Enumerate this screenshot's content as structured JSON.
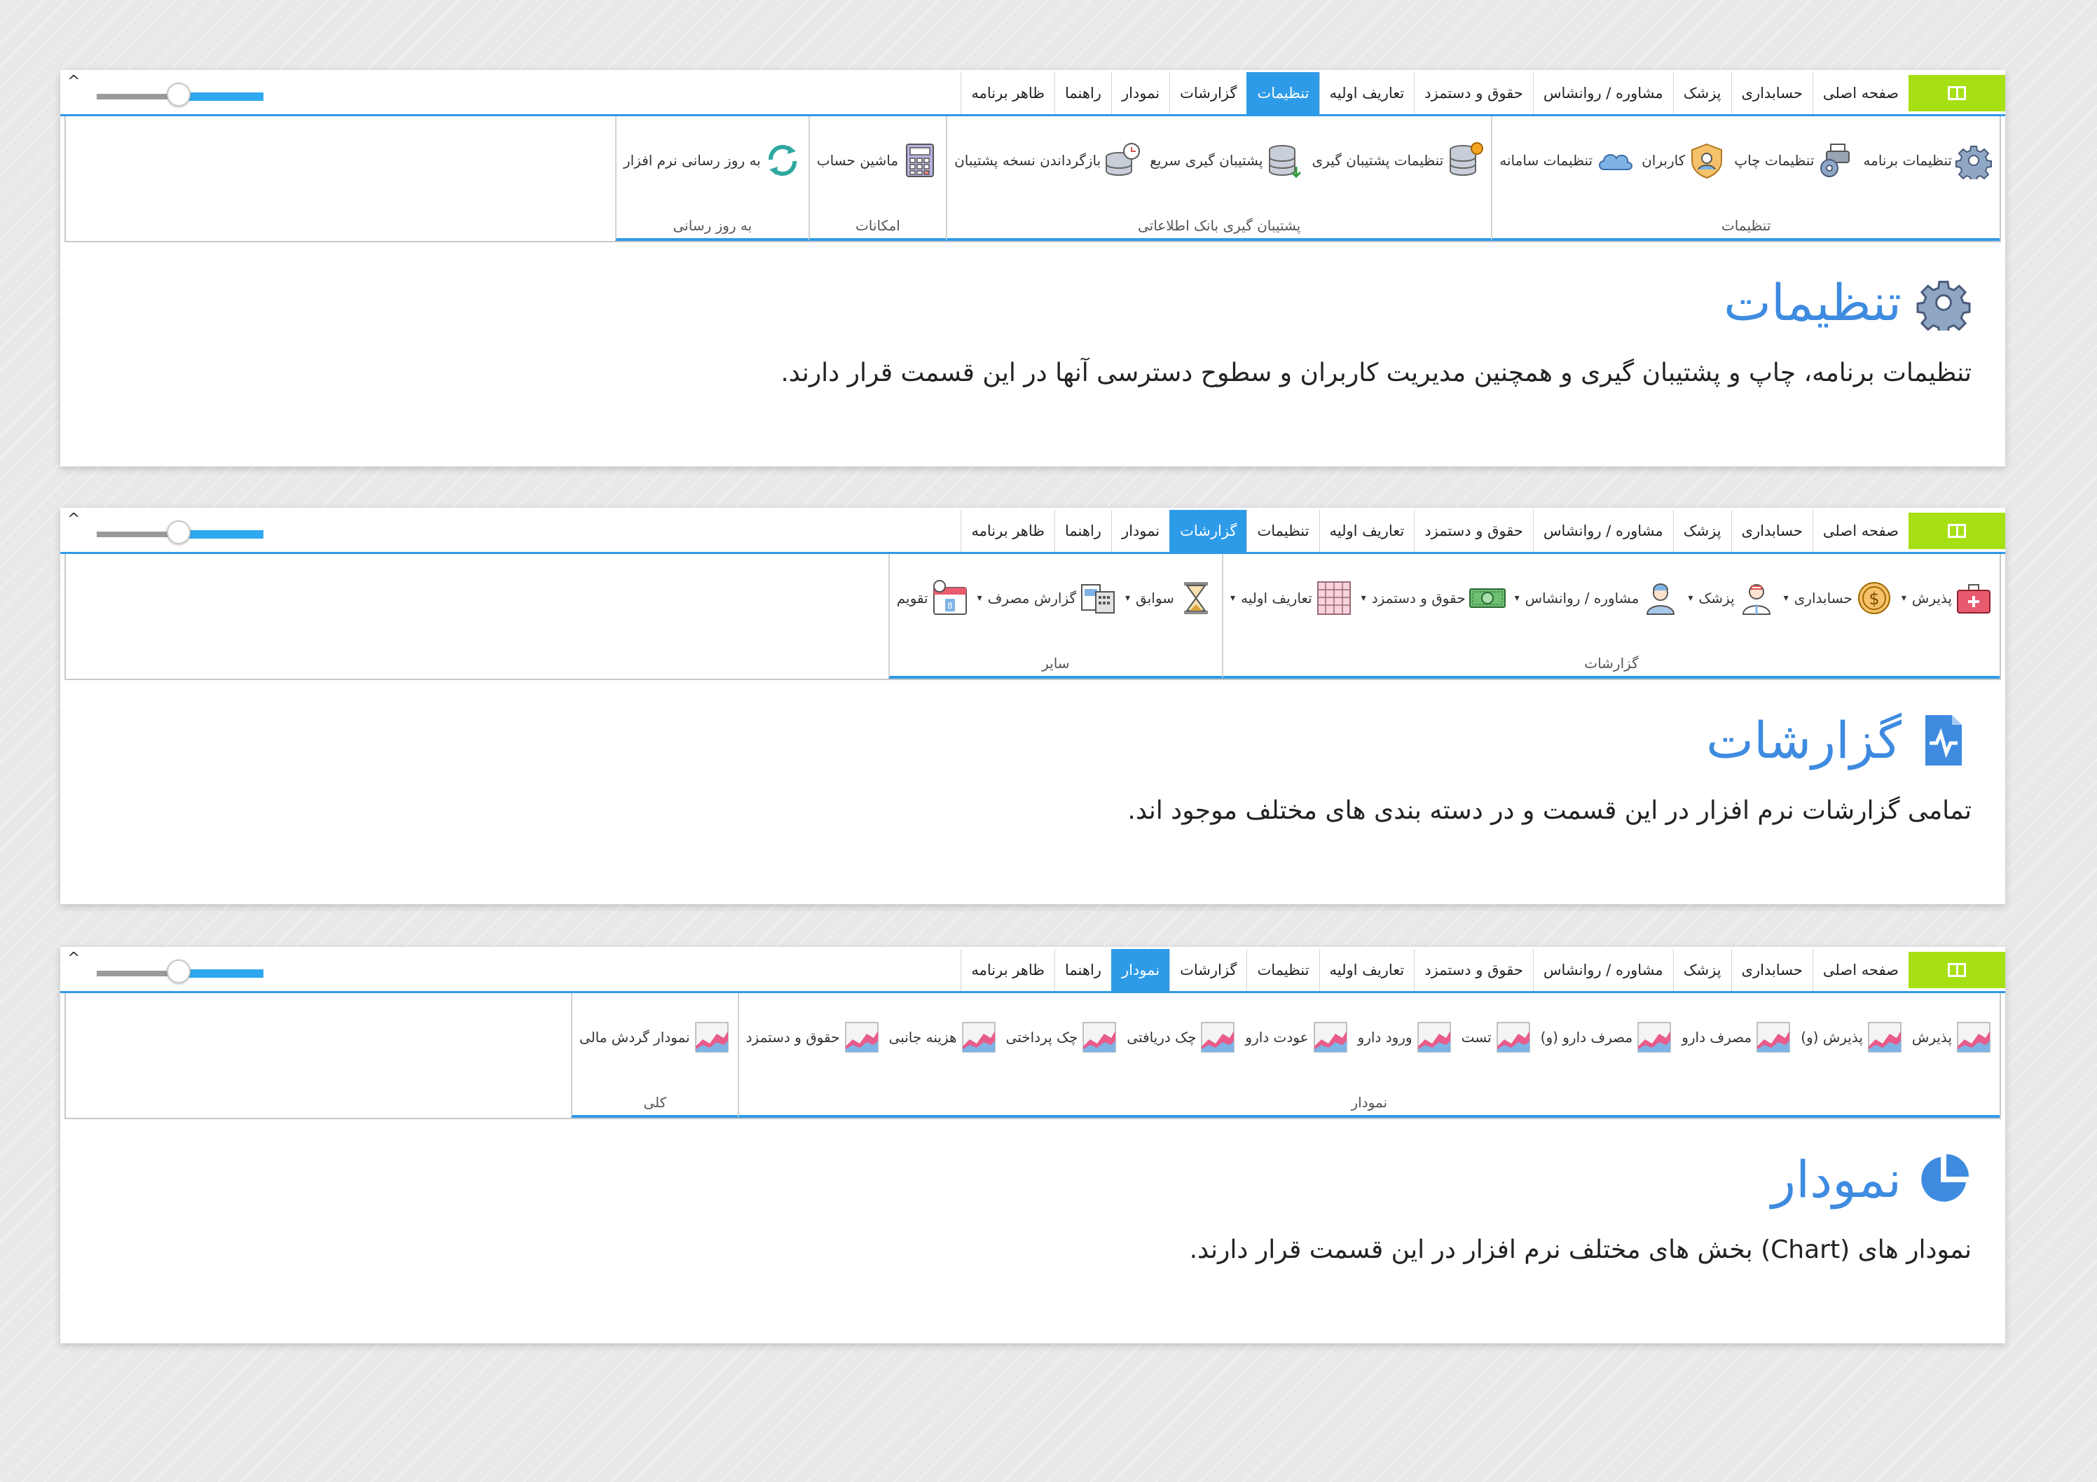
{
  "tabs": [
    "صفحه اصلی",
    "حسابداری",
    "پزشک",
    "مشاوره / روانشاس",
    "حقوق و دستمزد",
    "تعاریف اولیه",
    "تنظیمات",
    "گزارشات",
    "نمودار",
    "راهنما",
    "ظاهر برنامه"
  ],
  "collapse_glyph": "^",
  "colors": {
    "accent": "#2e9be8",
    "app_button": "#a6e012",
    "heading": "#3e8be0"
  },
  "panels": [
    {
      "active_tab": "تنظیمات",
      "groups": [
        {
          "label": "تنظیمات",
          "items": [
            {
              "label": "تنظیمات برنامه",
              "icon": "gear-icon",
              "dropdown": false
            },
            {
              "label": "تنظیمات چاپ",
              "icon": "print-settings-icon",
              "dropdown": false
            },
            {
              "label": "کاربران",
              "icon": "user-shield-icon",
              "dropdown": false
            },
            {
              "label": "تنظیمات سامانه",
              "icon": "cloud-icon",
              "dropdown": false
            }
          ]
        },
        {
          "label": "پشتیبان گیری بانک اطلاعاتی",
          "items": [
            {
              "label": "تنظیمات پشتیبان گیری",
              "icon": "database-gear-icon",
              "dropdown": false
            },
            {
              "label": "پشتیبان گیری سریع",
              "icon": "database-download-icon",
              "dropdown": false
            },
            {
              "label": "بازگرداندن نسخه پشتیبان",
              "icon": "database-restore-icon",
              "dropdown": false
            }
          ]
        },
        {
          "label": "امکانات",
          "items": [
            {
              "label": "ماشین حساب",
              "icon": "calculator-icon",
              "dropdown": false
            }
          ]
        },
        {
          "label": "به روز رسانی",
          "items": [
            {
              "label": "به روز رسانی نرم افزار",
              "icon": "refresh-icon",
              "dropdown": false
            }
          ]
        }
      ],
      "heading": "تنظیمات",
      "heading_icon": "gear-icon",
      "description": "تنظیمات برنامه، چاپ و پشتیبان گیری و همچنین مدیریت کاربران و سطوح دسترسی آنها در این قسمت قرار دارند."
    },
    {
      "active_tab": "گزارشات",
      "groups": [
        {
          "label": "گزارشات",
          "items": [
            {
              "label": "پذیرش",
              "icon": "medical-case-icon",
              "dropdown": true
            },
            {
              "label": "حسابداری",
              "icon": "coin-icon",
              "dropdown": true
            },
            {
              "label": "پزشک",
              "icon": "doctor-icon",
              "dropdown": true
            },
            {
              "label": "مشاوره / روانشاس",
              "icon": "nurse-icon",
              "dropdown": true
            },
            {
              "label": "حقوق و دستمزد",
              "icon": "money-icon",
              "dropdown": true
            },
            {
              "label": "تعاریف اولیه",
              "icon": "table-icon",
              "dropdown": true
            }
          ]
        },
        {
          "label": "سایر",
          "items": [
            {
              "label": "سوابق",
              "icon": "hourglass-icon",
              "dropdown": true
            },
            {
              "label": "گزارش مصرف",
              "icon": "report-icon",
              "dropdown": true
            },
            {
              "label": "تقویم",
              "icon": "calendar-icon",
              "dropdown": false
            }
          ]
        }
      ],
      "heading": "گزارشات",
      "heading_icon": "report-file-icon",
      "description": "تمامی گزارشات نرم افزار در این قسمت و در دسته بندی های مختلف موجود اند."
    },
    {
      "active_tab": "نمودار",
      "groups": [
        {
          "label": "نمودار",
          "items": [
            {
              "label": "پذیرش",
              "icon": "area-chart-icon",
              "dropdown": false
            },
            {
              "label": "پذیرش (و)",
              "icon": "area-chart-icon",
              "dropdown": false
            },
            {
              "label": "مصرف دارو",
              "icon": "area-chart-icon",
              "dropdown": false
            },
            {
              "label": "مصرف دارو (و)",
              "icon": "area-chart-icon",
              "dropdown": false
            },
            {
              "label": "تست",
              "icon": "area-chart-icon",
              "dropdown": false
            },
            {
              "label": "ورود دارو",
              "icon": "area-chart-icon",
              "dropdown": false
            },
            {
              "label": "عودت دارو",
              "icon": "area-chart-icon",
              "dropdown": false
            },
            {
              "label": "چک دریافتی",
              "icon": "area-chart-icon",
              "dropdown": false
            },
            {
              "label": "چک پرداختی",
              "icon": "area-chart-icon",
              "dropdown": false
            },
            {
              "label": "هزینه جانبی",
              "icon": "area-chart-icon",
              "dropdown": false
            },
            {
              "label": "حقوق و دستمزد",
              "icon": "area-chart-icon",
              "dropdown": false
            }
          ]
        },
        {
          "label": "کلی",
          "items": [
            {
              "label": "نمودار گردش مالی",
              "icon": "area-chart-icon",
              "dropdown": false
            }
          ]
        }
      ],
      "heading": "نمودار",
      "heading_icon": "pie-chart-icon",
      "description": "نمودار های (Chart) بخش های مختلف نرم افزار در این قسمت قرار دارند."
    }
  ]
}
